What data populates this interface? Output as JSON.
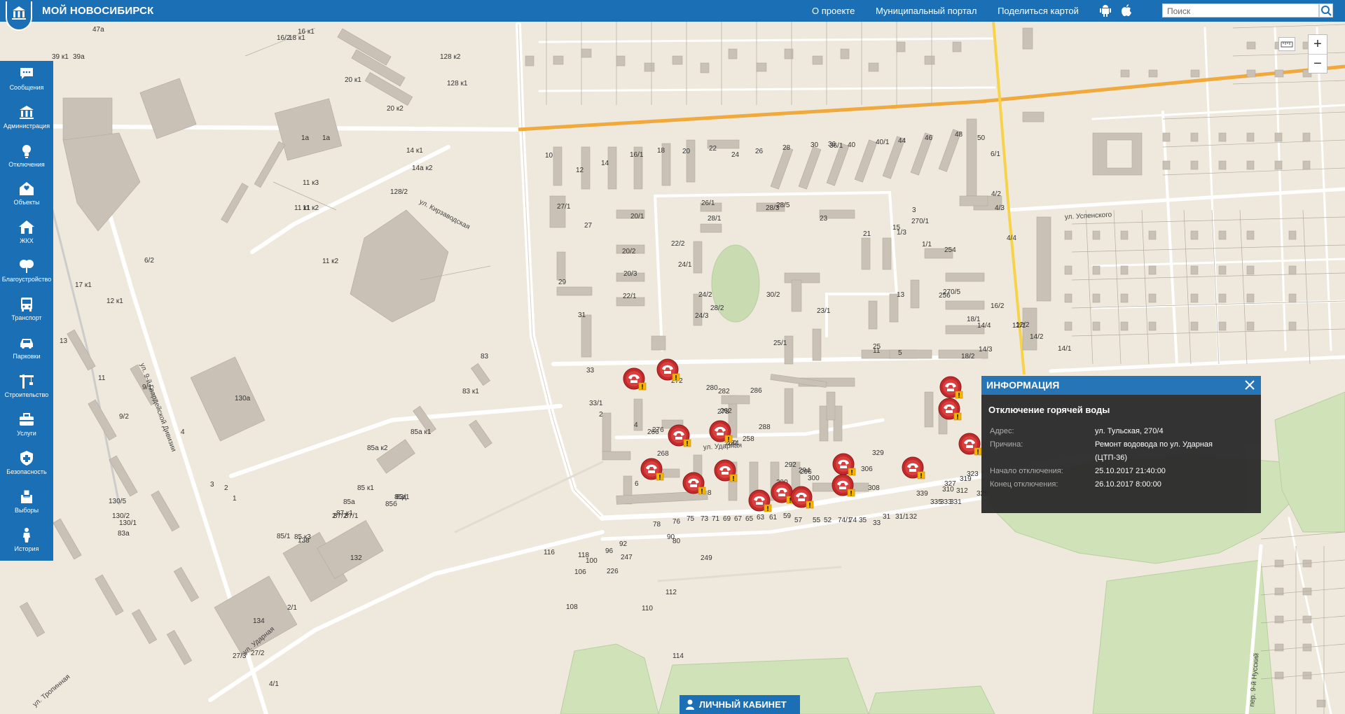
{
  "header": {
    "brand": "МОЙ НОВОСИБИРСК",
    "links": [
      "О проекте",
      "Муниципальный портал",
      "Поделиться картой"
    ],
    "search_placeholder": "Поиск"
  },
  "sidebar": {
    "items": [
      {
        "label": "Сообщения",
        "icon": "messages-icon"
      },
      {
        "label": "Администрация",
        "icon": "administration-icon"
      },
      {
        "label": "Отключения",
        "icon": "outages-icon"
      },
      {
        "label": "Объекты",
        "icon": "objects-icon"
      },
      {
        "label": "ЖКХ",
        "icon": "housing-icon"
      },
      {
        "label": "Благоустройство",
        "icon": "landscaping-icon"
      },
      {
        "label": "Транспорт",
        "icon": "transport-icon"
      },
      {
        "label": "Парковки",
        "icon": "parking-icon"
      },
      {
        "label": "Строительство",
        "icon": "construction-icon"
      },
      {
        "label": "Услуги",
        "icon": "services-icon"
      },
      {
        "label": "Безопасность",
        "icon": "security-icon"
      },
      {
        "label": "Выборы",
        "icon": "elections-icon"
      },
      {
        "label": "История",
        "icon": "history-icon"
      }
    ]
  },
  "popup": {
    "header": "ИНФОРМАЦИЯ",
    "title": "Отключение горячей воды",
    "rows": [
      {
        "key": "Адрес:",
        "value": "ул. Тульская, 270/4"
      },
      {
        "key": "Причина:",
        "value": "Ремонт водовода по ул. Ударная"
      },
      {
        "key": "",
        "value": "(ЦТП-36)"
      },
      {
        "key": "Начало отключения:",
        "value": "25.10.2017 21:40:00"
      },
      {
        "key": "Конец отключения:",
        "value": "26.10.2017 8:00:00"
      }
    ]
  },
  "map": {
    "streets": [
      "ул. Кирзаводская",
      "ул. 9-й Гвардейской Дивизии",
      "ул. Ударная",
      "ул. Успенского",
      "ул. Тропинная",
      "ул. Ударная",
      "пер. 9-й Нусский"
    ],
    "house_numbers": [
      "47а",
      "39 к1",
      "39а",
      "16/2",
      "18 к1",
      "16 к1",
      "20 к1",
      "20 к2",
      "128 к2",
      "128 к1",
      "1а",
      "1а",
      "14 к1",
      "14а к2",
      "128/2",
      "11 к3",
      "11 к1",
      "11 к2",
      "11 к2",
      "6/2",
      "17 к1",
      "12 к1",
      "13",
      "11",
      "9/1",
      "9/2",
      "4",
      "3",
      "2",
      "1",
      "130а",
      "130/5",
      "130/2",
      "130/1",
      "83а",
      "83",
      "83 к1",
      "85а к1",
      "85а к2",
      "85а",
      "85 к1",
      "85б",
      "85д",
      "83/1",
      "2",
      "85/1",
      "85 к3",
      "87/2",
      "87 к1",
      "87/1",
      "132",
      "138",
      "134",
      "2/1",
      "4/1",
      "27/3",
      "27/2",
      "27/1",
      "27",
      "29",
      "31",
      "33",
      "33/1",
      "2",
      "4",
      "6",
      "8",
      "10",
      "12",
      "14",
      "16/1",
      "18",
      "20",
      "22",
      "24",
      "26",
      "28",
      "30",
      "36",
      "36/1",
      "40",
      "40/1",
      "44",
      "46",
      "48",
      "50",
      "6/1",
      "4/2",
      "4/3",
      "4/4",
      "12/1",
      "12/2",
      "14/2",
      "14/1",
      "14/3",
      "14/4",
      "16/2",
      "18/1",
      "18/2",
      "20/1",
      "20/2",
      "20/3",
      "22/1",
      "22/2",
      "24/1",
      "24/2",
      "24/3",
      "26/1",
      "28/1",
      "28/2",
      "28/3",
      "28/5",
      "30/2",
      "25/1",
      "23",
      "23/1",
      "21",
      "25",
      "15",
      "13",
      "11",
      "5",
      "3",
      "1/1",
      "1/3",
      "270/1",
      "270/5",
      "254",
      "256",
      "258",
      "260",
      "262",
      "266",
      "268",
      "272",
      "276",
      "278",
      "280",
      "282",
      "284",
      "286",
      "288",
      "290",
      "292",
      "294",
      "296",
      "300",
      "306",
      "308",
      "310",
      "312",
      "319",
      "323",
      "325",
      "327",
      "329",
      "331",
      "333",
      "335",
      "339",
      "32",
      "31/1",
      "31",
      "33",
      "35",
      "74",
      "74/1",
      "52",
      "55",
      "57",
      "59",
      "61",
      "63",
      "65",
      "67",
      "69",
      "71",
      "73",
      "75",
      "76",
      "78",
      "80",
      "90",
      "92",
      "96",
      "100",
      "106",
      "108",
      "110",
      "112",
      "114",
      "116",
      "118",
      "226",
      "247",
      "249"
    ]
  },
  "footer": {
    "cabinet_label": "ЛИЧНЫЙ КАБИНЕТ"
  },
  "colors": {
    "brand_blue": "#1b6fb5",
    "map_bg": "#efe9dd",
    "building": "#c9c1b6",
    "road_main": "#f0a93c",
    "road_yellow": "#f7d34a",
    "park": "#c9dfb5",
    "marker_red": "#c42a2a",
    "marker_badge": "#f4b400"
  }
}
